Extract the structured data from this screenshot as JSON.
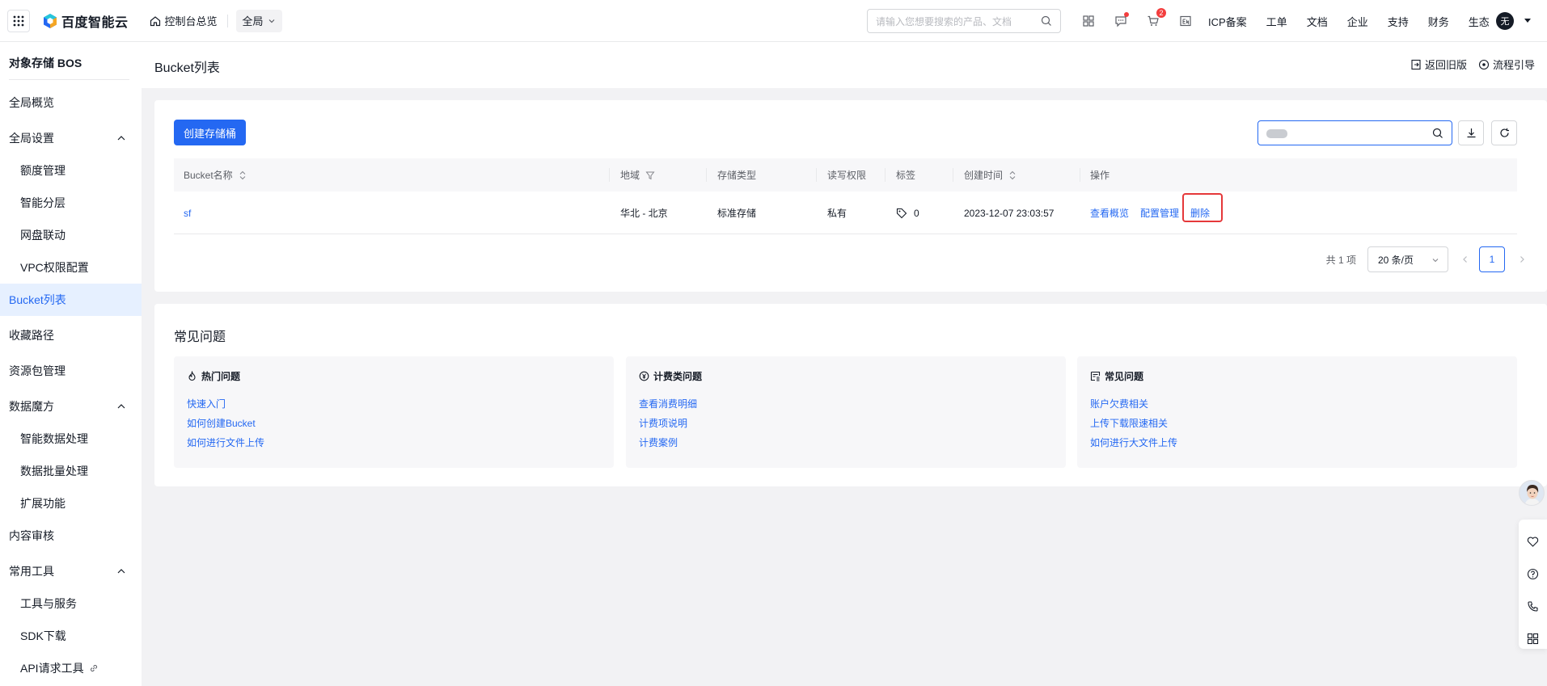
{
  "topbar": {
    "logo_text": "百度智能云",
    "home_label": "控制台总览",
    "region_label": "全局",
    "search_placeholder": "请输入您想要搜索的产品、文档",
    "cart_badge": "2",
    "nav": [
      "ICP备案",
      "工单",
      "文档",
      "企业",
      "支持",
      "财务",
      "生态"
    ],
    "avatar_text": "无"
  },
  "sidebar": {
    "title": "对象存储 BOS",
    "items": [
      {
        "label": "全局概览"
      },
      {
        "label": "全局设置"
      },
      {
        "label": "额度管理"
      },
      {
        "label": "智能分层"
      },
      {
        "label": "网盘联动"
      },
      {
        "label": "VPC权限配置"
      },
      {
        "label": "Bucket列表"
      },
      {
        "label": "收藏路径"
      },
      {
        "label": "资源包管理"
      },
      {
        "label": "数据魔方"
      },
      {
        "label": "智能数据处理"
      },
      {
        "label": "数据批量处理"
      },
      {
        "label": "扩展功能"
      },
      {
        "label": "内容审核"
      },
      {
        "label": "常用工具"
      },
      {
        "label": "工具与服务"
      },
      {
        "label": "SDK下载"
      },
      {
        "label": "API请求工具"
      }
    ]
  },
  "header": {
    "title": "Bucket列表",
    "back_old": "返回旧版",
    "guide": "流程引导"
  },
  "toolbar": {
    "create_label": "创建存储桶"
  },
  "table": {
    "columns": [
      "Bucket名称",
      "地域",
      "存储类型",
      "读写权限",
      "标签",
      "创建时间",
      "操作"
    ],
    "rows": [
      {
        "name": "sf",
        "region": "华北 - 北京",
        "storage_type": "标准存储",
        "permission": "私有",
        "tag_count": "0",
        "created": "2023-12-07 23:03:57",
        "actions": [
          "查看概览",
          "配置管理",
          "删除"
        ]
      }
    ]
  },
  "pagination": {
    "total": "共 1 项",
    "page_size": "20 条/页",
    "current": "1"
  },
  "faq": {
    "title": "常见问题",
    "columns": [
      {
        "title": "热门问题",
        "links": [
          "快速入门",
          "如何创建Bucket",
          "如何进行文件上传"
        ]
      },
      {
        "title": "计费类问题",
        "links": [
          "查看消费明细",
          "计费项说明",
          "计费案例"
        ]
      },
      {
        "title": "常见问题",
        "links": [
          "账户欠费相关",
          "上传下载限速相关",
          "如何进行大文件上传"
        ]
      }
    ]
  }
}
